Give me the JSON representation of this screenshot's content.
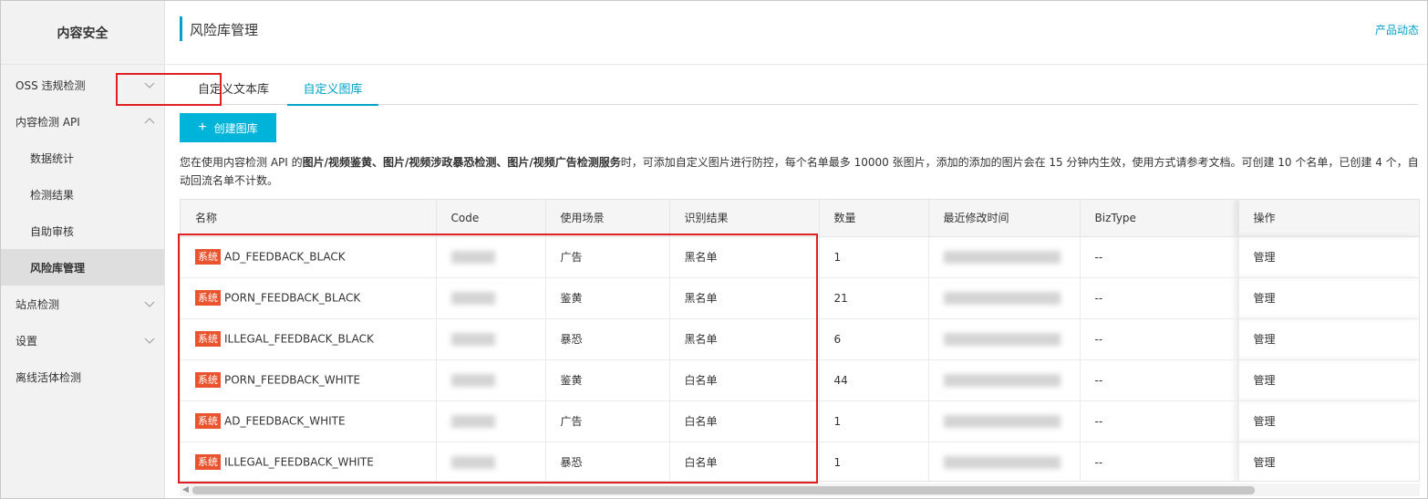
{
  "sidebar": {
    "title": "内容安全",
    "items": [
      {
        "label": "OSS 违规检测",
        "expandable": true,
        "expanded": false
      },
      {
        "label": "内容检测 API",
        "expandable": true,
        "expanded": true
      },
      {
        "label": "数据统计",
        "sub": true
      },
      {
        "label": "检测结果",
        "sub": true
      },
      {
        "label": "自助审核",
        "sub": true
      },
      {
        "label": "风险库管理",
        "sub": true,
        "active": true
      },
      {
        "label": "站点检测",
        "expandable": true,
        "expanded": false
      },
      {
        "label": "设置",
        "expandable": true,
        "expanded": false
      },
      {
        "label": "离线活体检测"
      }
    ]
  },
  "header": {
    "title": "风险库管理",
    "product_link": "产品动态"
  },
  "tabs": [
    {
      "label": "自定义文本库"
    },
    {
      "label": "自定义图库",
      "active": true
    }
  ],
  "create_button": {
    "label": "创建图库",
    "icon": "plus-icon"
  },
  "description": {
    "prefix": "您在使用内容检测 API 的",
    "bold": "图片/视频鉴黄、图片/视频涉政暴恐检测、图片/视频广告检测服务",
    "suffix": "时，可添加自定义图片进行防控，每个名单最多 10000 张图片，添加的添加的图片会在 15 分钟内生效，使用方式请参考文档。可创建 10 个名单，已创建 4 个，自动回流名单不计数。"
  },
  "table": {
    "columns": [
      "名称",
      "Code",
      "使用场景",
      "识别结果",
      "数量",
      "最近修改时间",
      "BizType",
      "操作"
    ],
    "rows": [
      {
        "badge": "系统",
        "name": "AD_FEEDBACK_BLACK",
        "scene": "广告",
        "result": "黑名单",
        "count": "1",
        "biztype": "--",
        "action": "管理"
      },
      {
        "badge": "系统",
        "name": "PORN_FEEDBACK_BLACK",
        "scene": "鉴黄",
        "result": "黑名单",
        "count": "21",
        "biztype": "--",
        "action": "管理"
      },
      {
        "badge": "系统",
        "name": "ILLEGAL_FEEDBACK_BLACK",
        "scene": "暴恐",
        "result": "黑名单",
        "count": "6",
        "biztype": "--",
        "action": "管理"
      },
      {
        "badge": "系统",
        "name": "PORN_FEEDBACK_WHITE",
        "scene": "鉴黄",
        "result": "白名单",
        "count": "44",
        "biztype": "--",
        "action": "管理"
      },
      {
        "badge": "系统",
        "name": "AD_FEEDBACK_WHITE",
        "scene": "广告",
        "result": "白名单",
        "count": "1",
        "biztype": "--",
        "action": "管理"
      },
      {
        "badge": "系统",
        "name": "ILLEGAL_FEEDBACK_WHITE",
        "scene": "暴恐",
        "result": "白名单",
        "count": "1",
        "biztype": "--",
        "action": "管理"
      }
    ]
  },
  "colors": {
    "accent": "#00a2ca",
    "button": "#00b3d8",
    "badge": "#e9542f",
    "highlight_box": "#e02020"
  }
}
